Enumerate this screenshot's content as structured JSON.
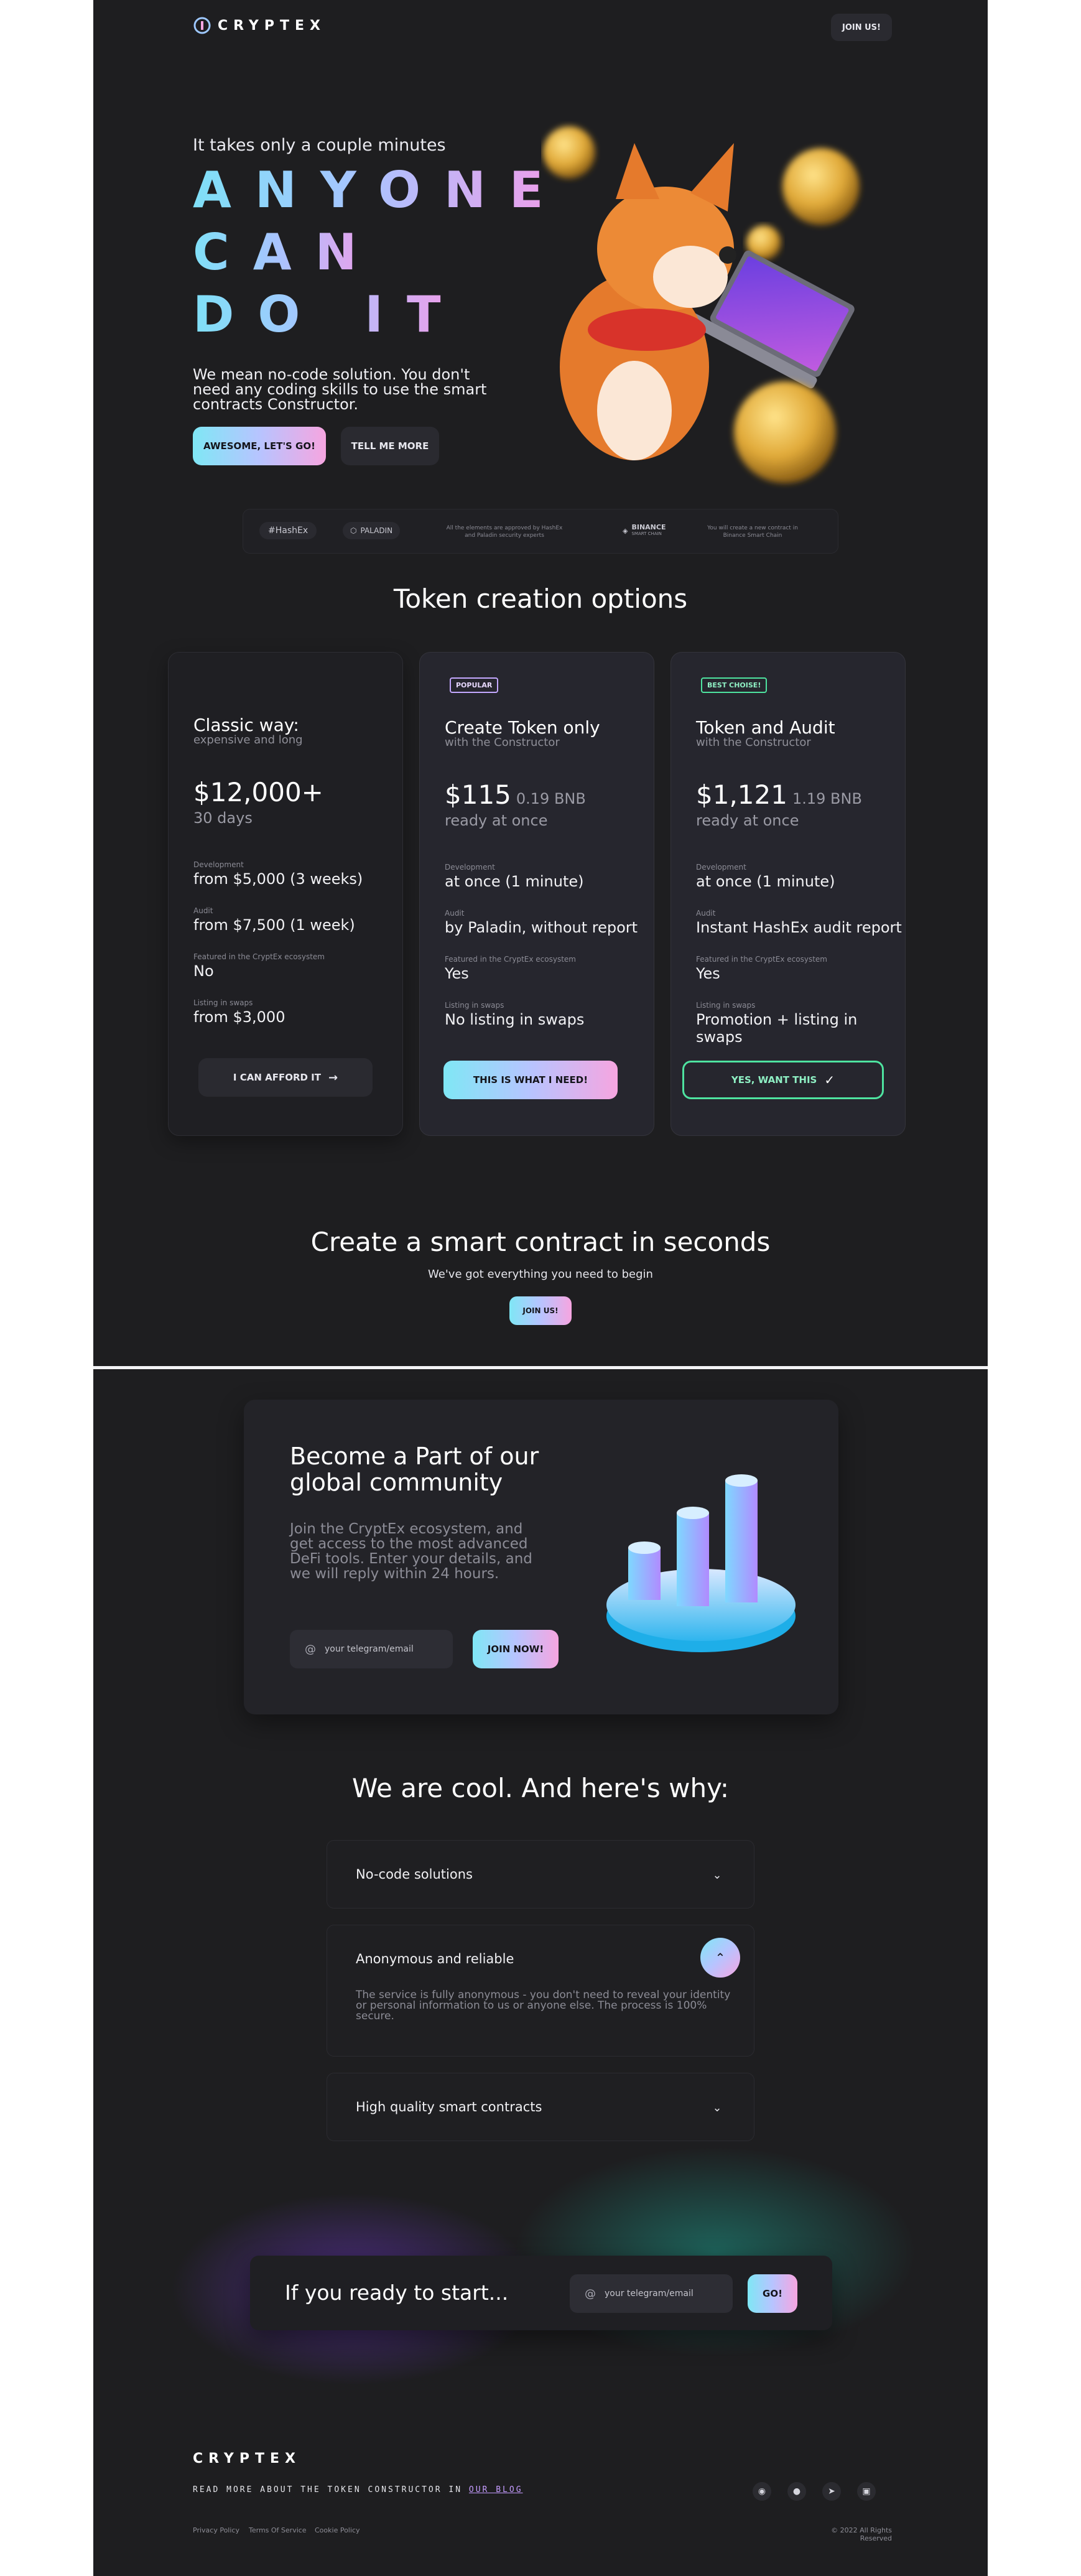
{
  "nav": {
    "logo_text": "CRYPTEX",
    "join_label": "JOIN US!"
  },
  "hero": {
    "kicker": "It takes only a couple minutes",
    "headline_lines": [
      "ANYONE",
      "CAN",
      "DO IT"
    ],
    "description": "We mean no-code solution. You don't need any coding skills to use the smart contracts Constructor.",
    "cta_primary": "AWESOME, LET'S GO!",
    "cta_secondary": "TELL ME MORE"
  },
  "partners": {
    "hashex": "HashEx",
    "paladin": "PALADIN",
    "paladin_note": "All the elements are approved by HashEx and Paladin security experts",
    "binance": "BINANCE",
    "binance_sub": "SMART CHAIN",
    "binance_note": "You will create a new contract in Binance Smart Chain"
  },
  "options": {
    "title": "Token creation options",
    "cards": [
      {
        "badge": "",
        "title": "Classic way:",
        "subtitle": "expensive and long",
        "price": "$12,000+",
        "price_bnb": "",
        "time": "30 days",
        "development_label": "Development",
        "development": "from $5,000 (3 weeks)",
        "audit_label": "Audit",
        "audit": "from $7,500 (1 week)",
        "featured_label": "Featured in the CryptEx ecosystem",
        "featured": "No",
        "listing_label": "Listing in swaps",
        "listing": "from $3,000",
        "button": "I CAN AFFORD IT"
      },
      {
        "badge": "POPULAR",
        "title": "Create Token only",
        "subtitle": "with the Constructor",
        "price": "$115",
        "price_bnb": "0.19 BNB",
        "time": "ready at once",
        "development_label": "Development",
        "development": "at once (1 minute)",
        "audit_label": "Audit",
        "audit": "by Paladin, without report",
        "featured_label": "Featured in the CryptEx ecosystem",
        "featured": "Yes",
        "listing_label": "Listing in swaps",
        "listing": "No listing in swaps",
        "button": "THIS IS WHAT I NEED!"
      },
      {
        "badge": "BEST CHOISE!",
        "title": "Token and Audit",
        "subtitle": "with the Constructor",
        "price": "$1,121",
        "price_bnb": "1.19 BNB",
        "time": "ready at once",
        "development_label": "Development",
        "development": "at once (1 minute)",
        "audit_label": "Audit",
        "audit": "Instant HashEx audit report",
        "featured_label": "Featured in the CryptEx ecosystem",
        "featured": "Yes",
        "listing_label": "Listing in swaps",
        "listing": "Promotion + listing in swaps",
        "button": "YES, WANT THIS"
      }
    ]
  },
  "smart": {
    "title": "Create a smart contract in seconds",
    "subtitle": "We've got everything you need to begin",
    "button": "JOIN US!"
  },
  "community": {
    "title": "Become a Part of our global community",
    "text": "Join the CryptEx ecosystem, and get access to the most advanced DeFi tools. Enter your details, and we will reply within 24 hours.",
    "input_placeholder": "your telegram/email",
    "button": "JOIN NOW!"
  },
  "why": {
    "title": "We are cool. And here's why:",
    "items": [
      {
        "question": "No-code solutions",
        "answer": ""
      },
      {
        "question": "Anonymous and reliable",
        "answer": "The service is fully anonymous - you don't need to reveal your identity or personal information to us or anyone else. The process is 100% secure."
      },
      {
        "question": "High quality smart contracts",
        "answer": ""
      }
    ]
  },
  "start": {
    "title": "If you ready to start...",
    "input_placeholder": "your telegram/email",
    "button": "GO!"
  },
  "footer": {
    "logo_text": "CRYPTEX",
    "blog_text": "READ MORE ABOUT THE TOKEN CONSTRUCTOR IN",
    "blog_link": "OUR BLOG",
    "links": [
      "Privacy Policy",
      "Terms Of Service",
      "Cookie Policy"
    ],
    "copyright": "© 2022 All Rights Reserved"
  },
  "icons": [
    "logo-icon",
    "arrow-right-icon",
    "check-icon",
    "at-icon",
    "chevron-down-icon",
    "chevron-up-icon",
    "eye-icon",
    "discord-icon",
    "telegram-icon",
    "medium-icon"
  ],
  "colors": {
    "page_bg": "#1e1e20",
    "card_bg": "#1f1f23",
    "card_highlight_bg": "#26262e",
    "gradient_start": "#7fe7f5",
    "gradient_mid": "#b7c4ff",
    "gradient_end": "#f6a5e0",
    "success_green": "#4ee3a0"
  }
}
